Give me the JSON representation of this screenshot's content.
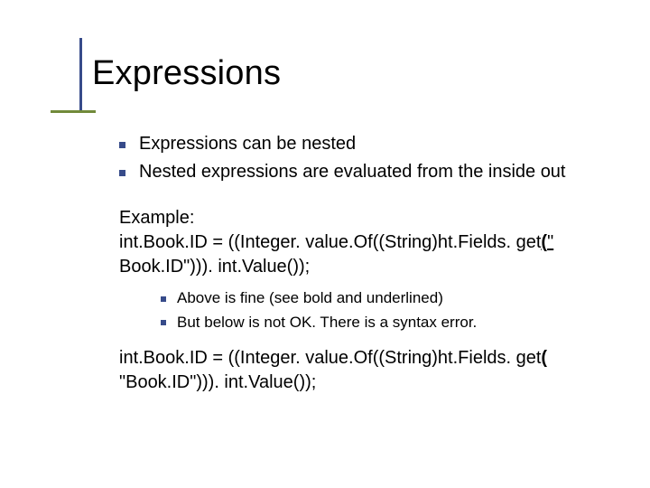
{
  "title": "Expressions",
  "bullets": {
    "top": [
      "Expressions can be nested",
      "Nested expressions are evaluated from the inside out"
    ],
    "sub": [
      "Above is fine (see bold and underlined)",
      "But below is not OK. There is a syntax error."
    ]
  },
  "example": {
    "label": "Example:",
    "good": {
      "pre": "int.Book.ID = ((Integer. value.Of((String)ht.Fields. get",
      "emph1": "(",
      "emph2": "\"",
      "post": " Book.ID\"))). int.Value());"
    },
    "bad": {
      "pre": "int.Book.ID = ((Integer. value.Of((String)ht.Fields. get",
      "emph": "(",
      "post": " \"Book.ID\"))). int.Value());"
    }
  }
}
